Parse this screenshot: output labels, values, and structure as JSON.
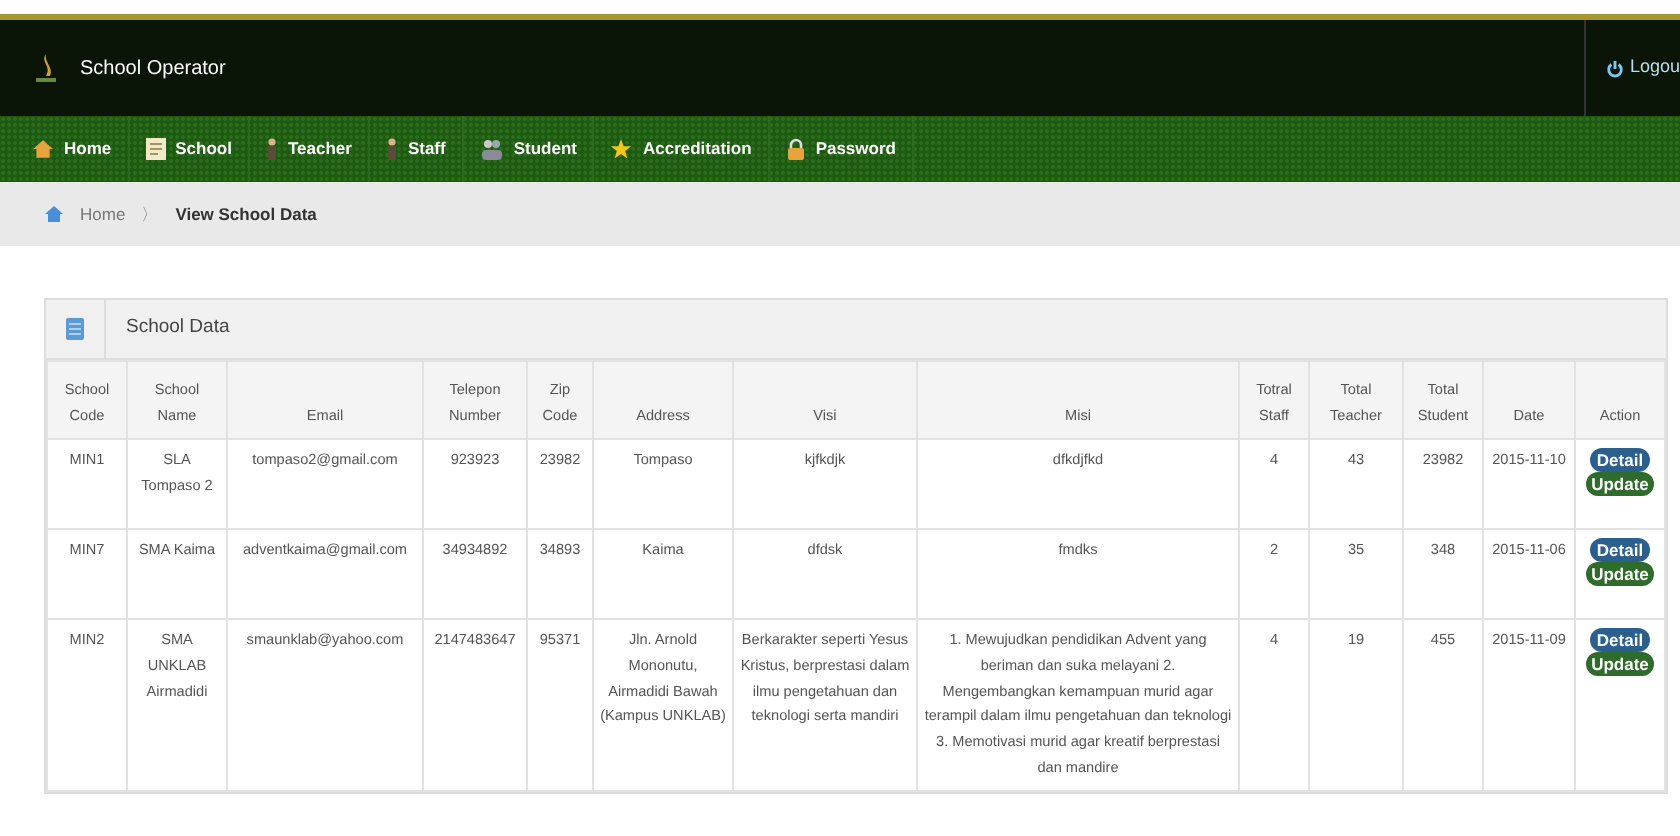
{
  "header": {
    "title": "School Operator",
    "logout": "Logou"
  },
  "menu": [
    {
      "label": "Home",
      "kind": "home"
    },
    {
      "label": "School",
      "kind": "book"
    },
    {
      "label": "Teacher",
      "kind": "person"
    },
    {
      "label": "Staff",
      "kind": "person"
    },
    {
      "label": "Student",
      "kind": "group"
    },
    {
      "label": "Accreditation",
      "kind": "star"
    },
    {
      "label": "Password",
      "kind": "lock"
    }
  ],
  "breadcrumb": {
    "home": "Home",
    "separator": "〉",
    "current": "View School Data"
  },
  "panel": {
    "title": "School Data"
  },
  "table": {
    "columns": [
      "School Code",
      "School Name",
      "Email",
      "Telepon Number",
      "Zip Code",
      "Address",
      "Visi",
      "Misi",
      "Totral Staff",
      "Total Teacher",
      "Total Student",
      "Date",
      "Action"
    ],
    "rows": [
      {
        "cells": [
          "MIN1",
          "SLA Tompaso 2",
          "tompaso2@gmail.com",
          "923923",
          "23982",
          "Tompaso",
          "kjfkdjk",
          "dfkdjfkd",
          "4",
          "43",
          "23982",
          "2015-11-10"
        ],
        "actions": [
          "Detail",
          "Update"
        ]
      },
      {
        "cells": [
          "MIN7",
          "SMA Kaima",
          "adventkaima@gmail.com",
          "34934892",
          "34893",
          "Kaima",
          "dfdsk",
          "fmdks",
          "2",
          "35",
          "348",
          "2015-11-06"
        ],
        "actions": [
          "Detail",
          "Update"
        ]
      },
      {
        "cells": [
          "MIN2",
          "SMA UNKLAB Airmadidi",
          "smaunklab@yahoo.com",
          "2147483647",
          "95371",
          "Jln. Arnold Mononutu, Airmadidi Bawah (Kampus UNKLAB)",
          "Berkarakter seperti Yesus Kristus, berprestasi dalam ilmu pengetahuan dan teknologi serta mandiri",
          "1. Mewujudkan pendidikan Advent yang beriman dan suka melayani 2. Mengembangkan kemampuan murid agar terampil dalam ilmu pengetahuan dan teknologi 3. Memotivasi murid agar kreatif berprestasi dan mandire",
          "4",
          "19",
          "455",
          "2015-11-09"
        ],
        "actions": [
          "Detail",
          "Update"
        ]
      }
    ]
  }
}
